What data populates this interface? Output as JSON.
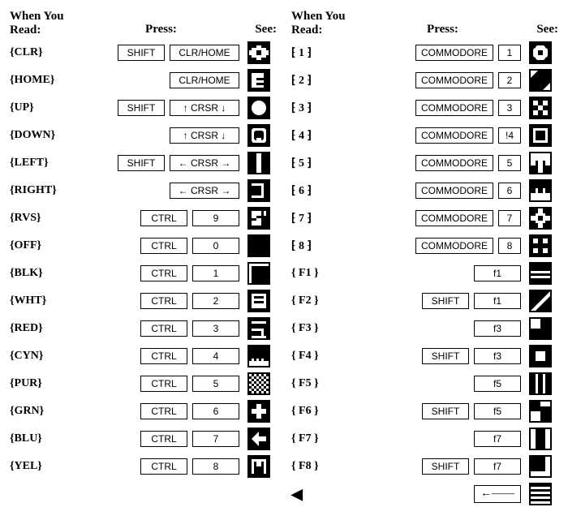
{
  "headers": {
    "read_line1": "When You",
    "read_line2": "Read:",
    "press": "Press:",
    "see": "See:"
  },
  "left": [
    {
      "read": "{CLR}",
      "keys": [
        "SHIFT",
        "CLR/HOME"
      ]
    },
    {
      "read": "{HOME}",
      "keys": [
        "CLR/HOME"
      ]
    },
    {
      "read": "{UP}",
      "keys": [
        "SHIFT",
        "↑ CRSR ↓"
      ]
    },
    {
      "read": "{DOWN}",
      "keys": [
        "↑ CRSR ↓"
      ]
    },
    {
      "read": "{LEFT}",
      "keys": [
        "SHIFT",
        "← CRSR →"
      ]
    },
    {
      "read": "{RIGHT}",
      "keys": [
        "← CRSR →"
      ]
    },
    {
      "read": "{RVS}",
      "keys": [
        "CTRL",
        "9"
      ]
    },
    {
      "read": "{OFF}",
      "keys": [
        "CTRL",
        "0"
      ]
    },
    {
      "read": "{BLK}",
      "keys": [
        "CTRL",
        "1"
      ]
    },
    {
      "read": "{WHT}",
      "keys": [
        "CTRL",
        "2"
      ]
    },
    {
      "read": "{RED}",
      "keys": [
        "CTRL",
        "3"
      ]
    },
    {
      "read": "{CYN}",
      "keys": [
        "CTRL",
        "4"
      ]
    },
    {
      "read": "{PUR}",
      "keys": [
        "CTRL",
        "5"
      ]
    },
    {
      "read": "{GRN}",
      "keys": [
        "CTRL",
        "6"
      ]
    },
    {
      "read": "{BLU}",
      "keys": [
        "CTRL",
        "7"
      ]
    },
    {
      "read": "{YEL}",
      "keys": [
        "CTRL",
        "8"
      ]
    }
  ],
  "right": [
    {
      "read": "1",
      "keys": [
        "COMMODORE",
        "1"
      ]
    },
    {
      "read": "2",
      "keys": [
        "COMMODORE",
        "2"
      ]
    },
    {
      "read": "3",
      "keys": [
        "COMMODORE",
        "3"
      ]
    },
    {
      "read": "4",
      "keys": [
        "COMMODORE",
        "!4"
      ]
    },
    {
      "read": "5",
      "keys": [
        "COMMODORE",
        "5"
      ]
    },
    {
      "read": "6",
      "keys": [
        "COMMODORE",
        "6"
      ]
    },
    {
      "read": "7",
      "keys": [
        "COMMODORE",
        "7"
      ]
    },
    {
      "read": "8",
      "keys": [
        "COMMODORE",
        "8"
      ]
    },
    {
      "read": "{ F1 }",
      "keys": [
        "f1"
      ]
    },
    {
      "read": "{ F2 }",
      "keys": [
        "SHIFT",
        "f1"
      ]
    },
    {
      "read": "{ F3 }",
      "keys": [
        "f3"
      ]
    },
    {
      "read": "{ F4 }",
      "keys": [
        "SHIFT",
        "f3"
      ]
    },
    {
      "read": "{ F5 }",
      "keys": [
        "f5"
      ]
    },
    {
      "read": "{ F6 }",
      "keys": [
        "SHIFT",
        "f5"
      ]
    },
    {
      "read": "{ F7 }",
      "keys": [
        "f7"
      ]
    },
    {
      "read": "{ F8 }",
      "keys": [
        "SHIFT",
        "f7"
      ]
    }
  ],
  "right_bracket_template": {
    "open": "⁅",
    "close": "⁆"
  },
  "arrow_row": {
    "read_glyph": "◀",
    "key_glyph": "←——"
  }
}
